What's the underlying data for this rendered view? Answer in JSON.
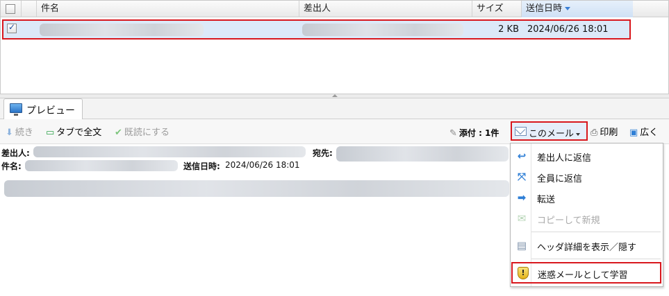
{
  "list": {
    "columns": {
      "subject": "件名",
      "sender": "差出人",
      "size": "サイズ",
      "sent_at": "送信日時"
    },
    "rows": [
      {
        "checked": true,
        "size": "2 KB",
        "sent_at": "2024/06/26 18:01"
      }
    ]
  },
  "preview": {
    "tab_label": "プレビュー",
    "toolbar": {
      "next": "続き",
      "full_in_tab": "タブで全文",
      "mark_read": "既読にする",
      "attachments": "添付 : 1件",
      "this_mail": "このメール",
      "print": "印刷",
      "wide": "広く"
    },
    "header": {
      "from_label": "差出人:",
      "to_label": "宛先:",
      "subject_label": "件名:",
      "sent_label": "送信日時:",
      "sent_value": "2024/06/26 18:01"
    }
  },
  "menu": {
    "items": {
      "reply": "差出人に返信",
      "reply_all": "全員に返信",
      "forward": "転送",
      "copy_new": "コピーして新規",
      "toggle_headers": "ヘッダ詳細を表示／隠す",
      "learn_spam": "迷惑メールとして学習"
    }
  },
  "colors": {
    "highlight_border": "#d8171d",
    "selected_row": "#dce9f8",
    "sorted_header": "#cfe0f5",
    "icon_blue": "#2f7fd6"
  },
  "icons": [
    "monitor-icon",
    "download-arrow-icon",
    "tab-plus-icon",
    "check-icon",
    "paperclip-icon",
    "envelope-icon",
    "printer-icon",
    "window-icon",
    "reply-icon",
    "reply-all-icon",
    "forward-icon",
    "copy-new-icon",
    "document-icon",
    "shield-icon"
  ]
}
